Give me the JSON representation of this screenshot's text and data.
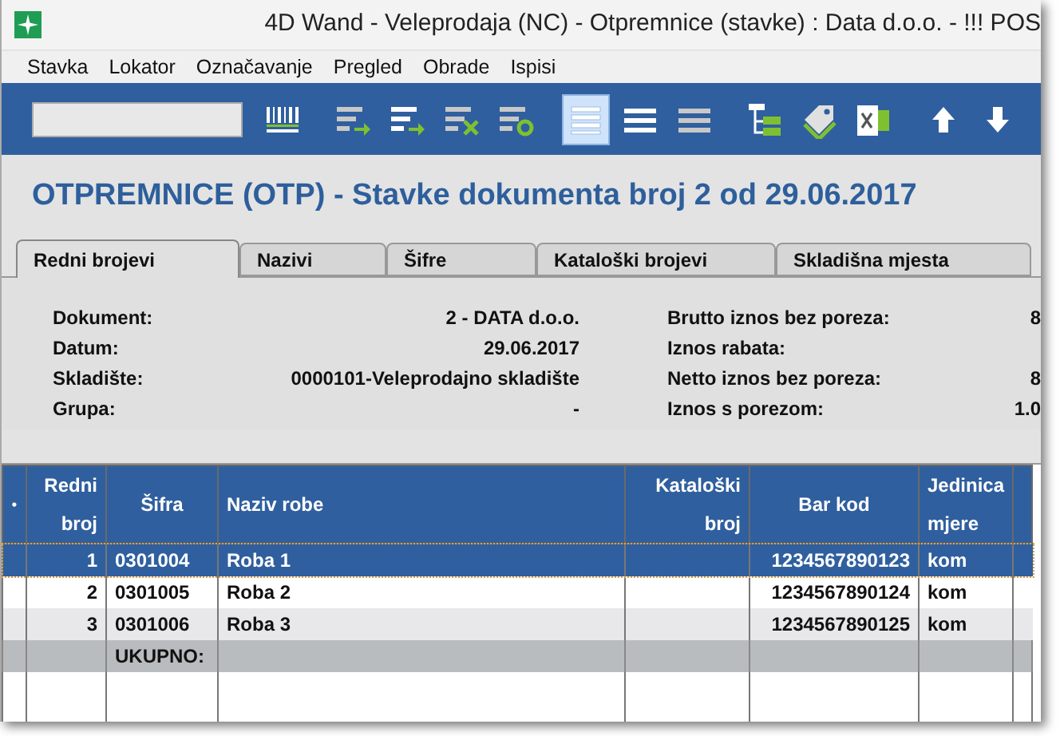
{
  "window": {
    "title": "4D Wand - Veleprodaja (NC) - Otpremnice (stavke) : Data d.o.o. - !!! POS"
  },
  "menu": [
    "Stavka",
    "Lokator",
    "Označavanje",
    "Pregled",
    "Obrade",
    "Ispisi"
  ],
  "toolbar": {
    "buttons": [
      {
        "kind": "barcode",
        "selected": false
      },
      {
        "kind": "list-add",
        "selected": false
      },
      {
        "kind": "list-add-bright",
        "selected": false
      },
      {
        "kind": "list-delete",
        "selected": false
      },
      {
        "kind": "list-refresh",
        "selected": false
      },
      {
        "kind": "view-rows",
        "selected": true
      },
      {
        "kind": "view-compact",
        "selected": false
      },
      {
        "kind": "view-dense",
        "selected": false
      },
      {
        "kind": "tree",
        "selected": false
      },
      {
        "kind": "tag",
        "selected": false
      },
      {
        "kind": "excel",
        "selected": false
      },
      {
        "kind": "up",
        "selected": false
      },
      {
        "kind": "down",
        "selected": false
      }
    ]
  },
  "heading": "OTPREMNICE (OTP) - Stavke dokumenta broj 2 od 29.06.2017",
  "tabs": [
    {
      "label": "Redni brojevi",
      "selected": true
    },
    {
      "label": "Nazivi",
      "selected": false
    },
    {
      "label": "Šifre",
      "selected": false
    },
    {
      "label": "Kataloški brojevi",
      "selected": false
    },
    {
      "label": "Skladišna mjesta",
      "selected": false
    }
  ],
  "details_left": [
    {
      "label": "Dokument:",
      "value": "2 - DATA d.o.o."
    },
    {
      "label": "Datum:",
      "value": "29.06.2017"
    },
    {
      "label": "Skladište:",
      "value": "0000101-Veleprodajno skladište"
    },
    {
      "label": "Grupa:",
      "value": "-"
    }
  ],
  "details_right": [
    {
      "label": "Brutto iznos bez poreza:",
      "value": "8"
    },
    {
      "label": "Iznos rabata:"
    },
    {
      "label": "Netto iznos bez poreza:",
      "value": "8"
    },
    {
      "label": "Iznos s porezom:",
      "value": "1.0"
    }
  ],
  "table": {
    "columns": [
      "•",
      "Redni broj",
      "Šifra",
      "Naziv robe",
      "Kataloški broj",
      "Bar kod",
      "Jedinica mjere"
    ],
    "rows": [
      {
        "selected": true,
        "cells": [
          "",
          "1",
          "0301004",
          "Roba 1",
          "",
          "1234567890123",
          "kom"
        ]
      },
      {
        "selected": false,
        "cells": [
          "",
          "2",
          "0301005",
          "Roba 2",
          "",
          "1234567890124",
          "kom"
        ]
      },
      {
        "selected": false,
        "cells": [
          "",
          "3",
          "0301006",
          "Roba 3",
          "",
          "1234567890125",
          "kom"
        ]
      }
    ],
    "total_label": "UKUPNO:"
  }
}
